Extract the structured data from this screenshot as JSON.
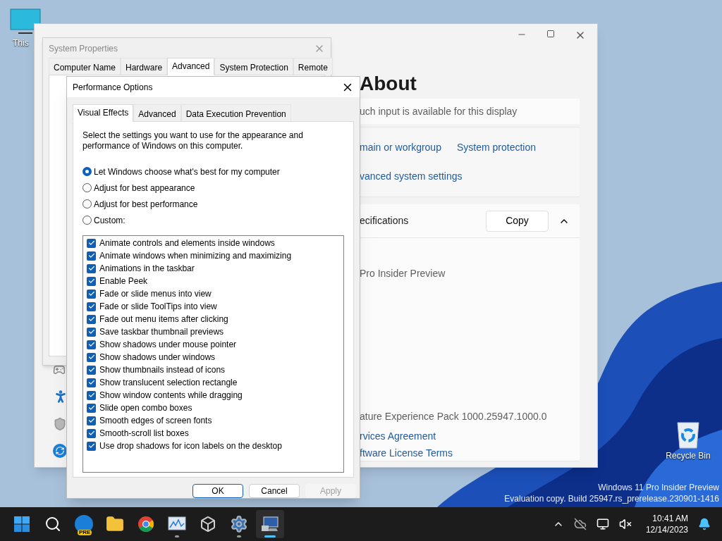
{
  "desktop": {
    "icons": [
      {
        "kind": "pc",
        "label": "This"
      },
      {
        "kind": "bin",
        "label": "Recycle Bin"
      }
    ],
    "watermark": [
      "Windows 11 Pro Insider Preview",
      "Evaluation copy. Build 25947.rs_prerelease.230901-1416"
    ]
  },
  "settings_window": {
    "title": "About",
    "touch_text": "uch input is available for this display",
    "links": [
      "main or workgroup",
      "System protection",
      "vanced system settings"
    ],
    "specs_heading": "ecifications",
    "copy_button": "Copy",
    "expanded": true,
    "edition": "Pro Insider Preview",
    "experience": "ature Experience Pack 1000.25947.1000.0",
    "footer_links": [
      "rvices Agreement",
      "ftware License Terms"
    ]
  },
  "system_properties": {
    "title": "System Properties",
    "tabs": [
      {
        "label": "Computer Name",
        "selected": false
      },
      {
        "label": "Hardware",
        "selected": false
      },
      {
        "label": "Advanced",
        "selected": true
      },
      {
        "label": "System Protection",
        "selected": false
      },
      {
        "label": "Remote",
        "selected": false
      }
    ]
  },
  "performance_options": {
    "title": "Performance Options",
    "tabs": [
      {
        "label": "Visual Effects",
        "selected": true
      },
      {
        "label": "Advanced",
        "selected": false
      },
      {
        "label": "Data Execution Prevention",
        "selected": false
      }
    ],
    "description": "Select the settings you want to use for the appearance and performance of Windows on this computer.",
    "radios": [
      {
        "label": "Let Windows choose what's best for my computer",
        "selected": true
      },
      {
        "label": "Adjust for best appearance",
        "selected": false
      },
      {
        "label": "Adjust for best performance",
        "selected": false
      },
      {
        "label": "Custom:",
        "selected": false
      }
    ],
    "effects": [
      {
        "label": "Animate controls and elements inside windows",
        "checked": true
      },
      {
        "label": "Animate windows when minimizing and maximizing",
        "checked": true
      },
      {
        "label": "Animations in the taskbar",
        "checked": true
      },
      {
        "label": "Enable Peek",
        "checked": true
      },
      {
        "label": "Fade or slide menus into view",
        "checked": true
      },
      {
        "label": "Fade or slide ToolTips into view",
        "checked": true
      },
      {
        "label": "Fade out menu items after clicking",
        "checked": true
      },
      {
        "label": "Save taskbar thumbnail previews",
        "checked": true
      },
      {
        "label": "Show shadows under mouse pointer",
        "checked": true
      },
      {
        "label": "Show shadows under windows",
        "checked": true
      },
      {
        "label": "Show thumbnails instead of icons",
        "checked": true
      },
      {
        "label": "Show translucent selection rectangle",
        "checked": true
      },
      {
        "label": "Show window contents while dragging",
        "checked": true
      },
      {
        "label": "Slide open combo boxes",
        "checked": true
      },
      {
        "label": "Smooth edges of screen fonts",
        "checked": true
      },
      {
        "label": "Smooth-scroll list boxes",
        "checked": true
      },
      {
        "label": "Use drop shadows for icon labels on the desktop",
        "checked": true
      }
    ],
    "buttons": [
      {
        "label": "OK",
        "default": true,
        "disabled": false
      },
      {
        "label": "Cancel",
        "default": false,
        "disabled": false
      },
      {
        "label": "Apply",
        "default": false,
        "disabled": true
      }
    ]
  },
  "taskbar": {
    "apps": [
      {
        "kind": "start",
        "running": false,
        "active": false
      },
      {
        "kind": "search",
        "running": false,
        "active": false
      },
      {
        "kind": "edge",
        "badge": "PRE",
        "running": false,
        "active": false
      },
      {
        "kind": "folder",
        "running": false,
        "active": false
      },
      {
        "kind": "chrome",
        "running": false,
        "active": false
      },
      {
        "kind": "monitor",
        "running": true,
        "active": false
      },
      {
        "kind": "cube",
        "running": false,
        "active": false
      },
      {
        "kind": "gear",
        "running": true,
        "active": false
      },
      {
        "kind": "system",
        "running": true,
        "active": true
      }
    ],
    "time": "10:41 AM",
    "date": "12/14/2023"
  }
}
